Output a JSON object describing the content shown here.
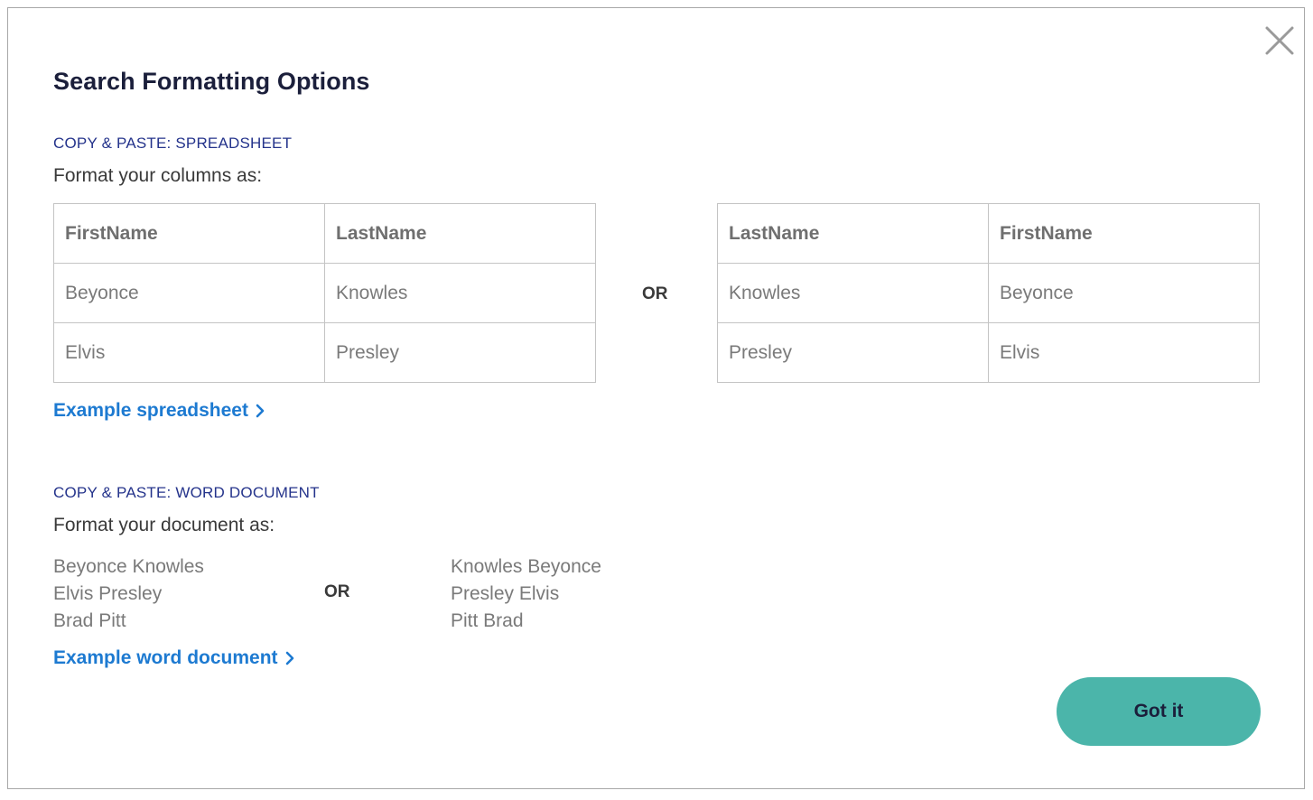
{
  "modal": {
    "title": "Search Formatting Options",
    "close_icon": "close-icon",
    "colors": {
      "title": "#1b1f3b",
      "section_label": "#24338b",
      "link": "#1d7ad1",
      "button_bg": "#4bb5aa"
    }
  },
  "spreadsheet": {
    "section_label": "COPY & PASTE: SPREADSHEET",
    "instruction": "Format your columns as:",
    "or_label": "OR",
    "table_a": {
      "headers": [
        "FirstName",
        "LastName"
      ],
      "rows": [
        [
          "Beyonce",
          "Knowles"
        ],
        [
          "Elvis",
          "Presley"
        ]
      ]
    },
    "table_b": {
      "headers": [
        "LastName",
        "FirstName"
      ],
      "rows": [
        [
          "Knowles",
          "Beyonce"
        ],
        [
          "Presley",
          "Elvis"
        ]
      ]
    },
    "example_link": "Example spreadsheet",
    "link_icon": "chevron-right-icon"
  },
  "word_document": {
    "section_label": "COPY & PASTE: WORD DOCUMENT",
    "instruction": "Format your document as:",
    "or_label": "OR",
    "list_a": [
      "Beyonce Knowles",
      "Elvis Presley",
      "Brad Pitt"
    ],
    "list_b": [
      "Knowles Beyonce",
      "Presley Elvis",
      "Pitt Brad"
    ],
    "example_link": "Example word document",
    "link_icon": "chevron-right-icon"
  },
  "footer": {
    "confirm_button": "Got it"
  }
}
